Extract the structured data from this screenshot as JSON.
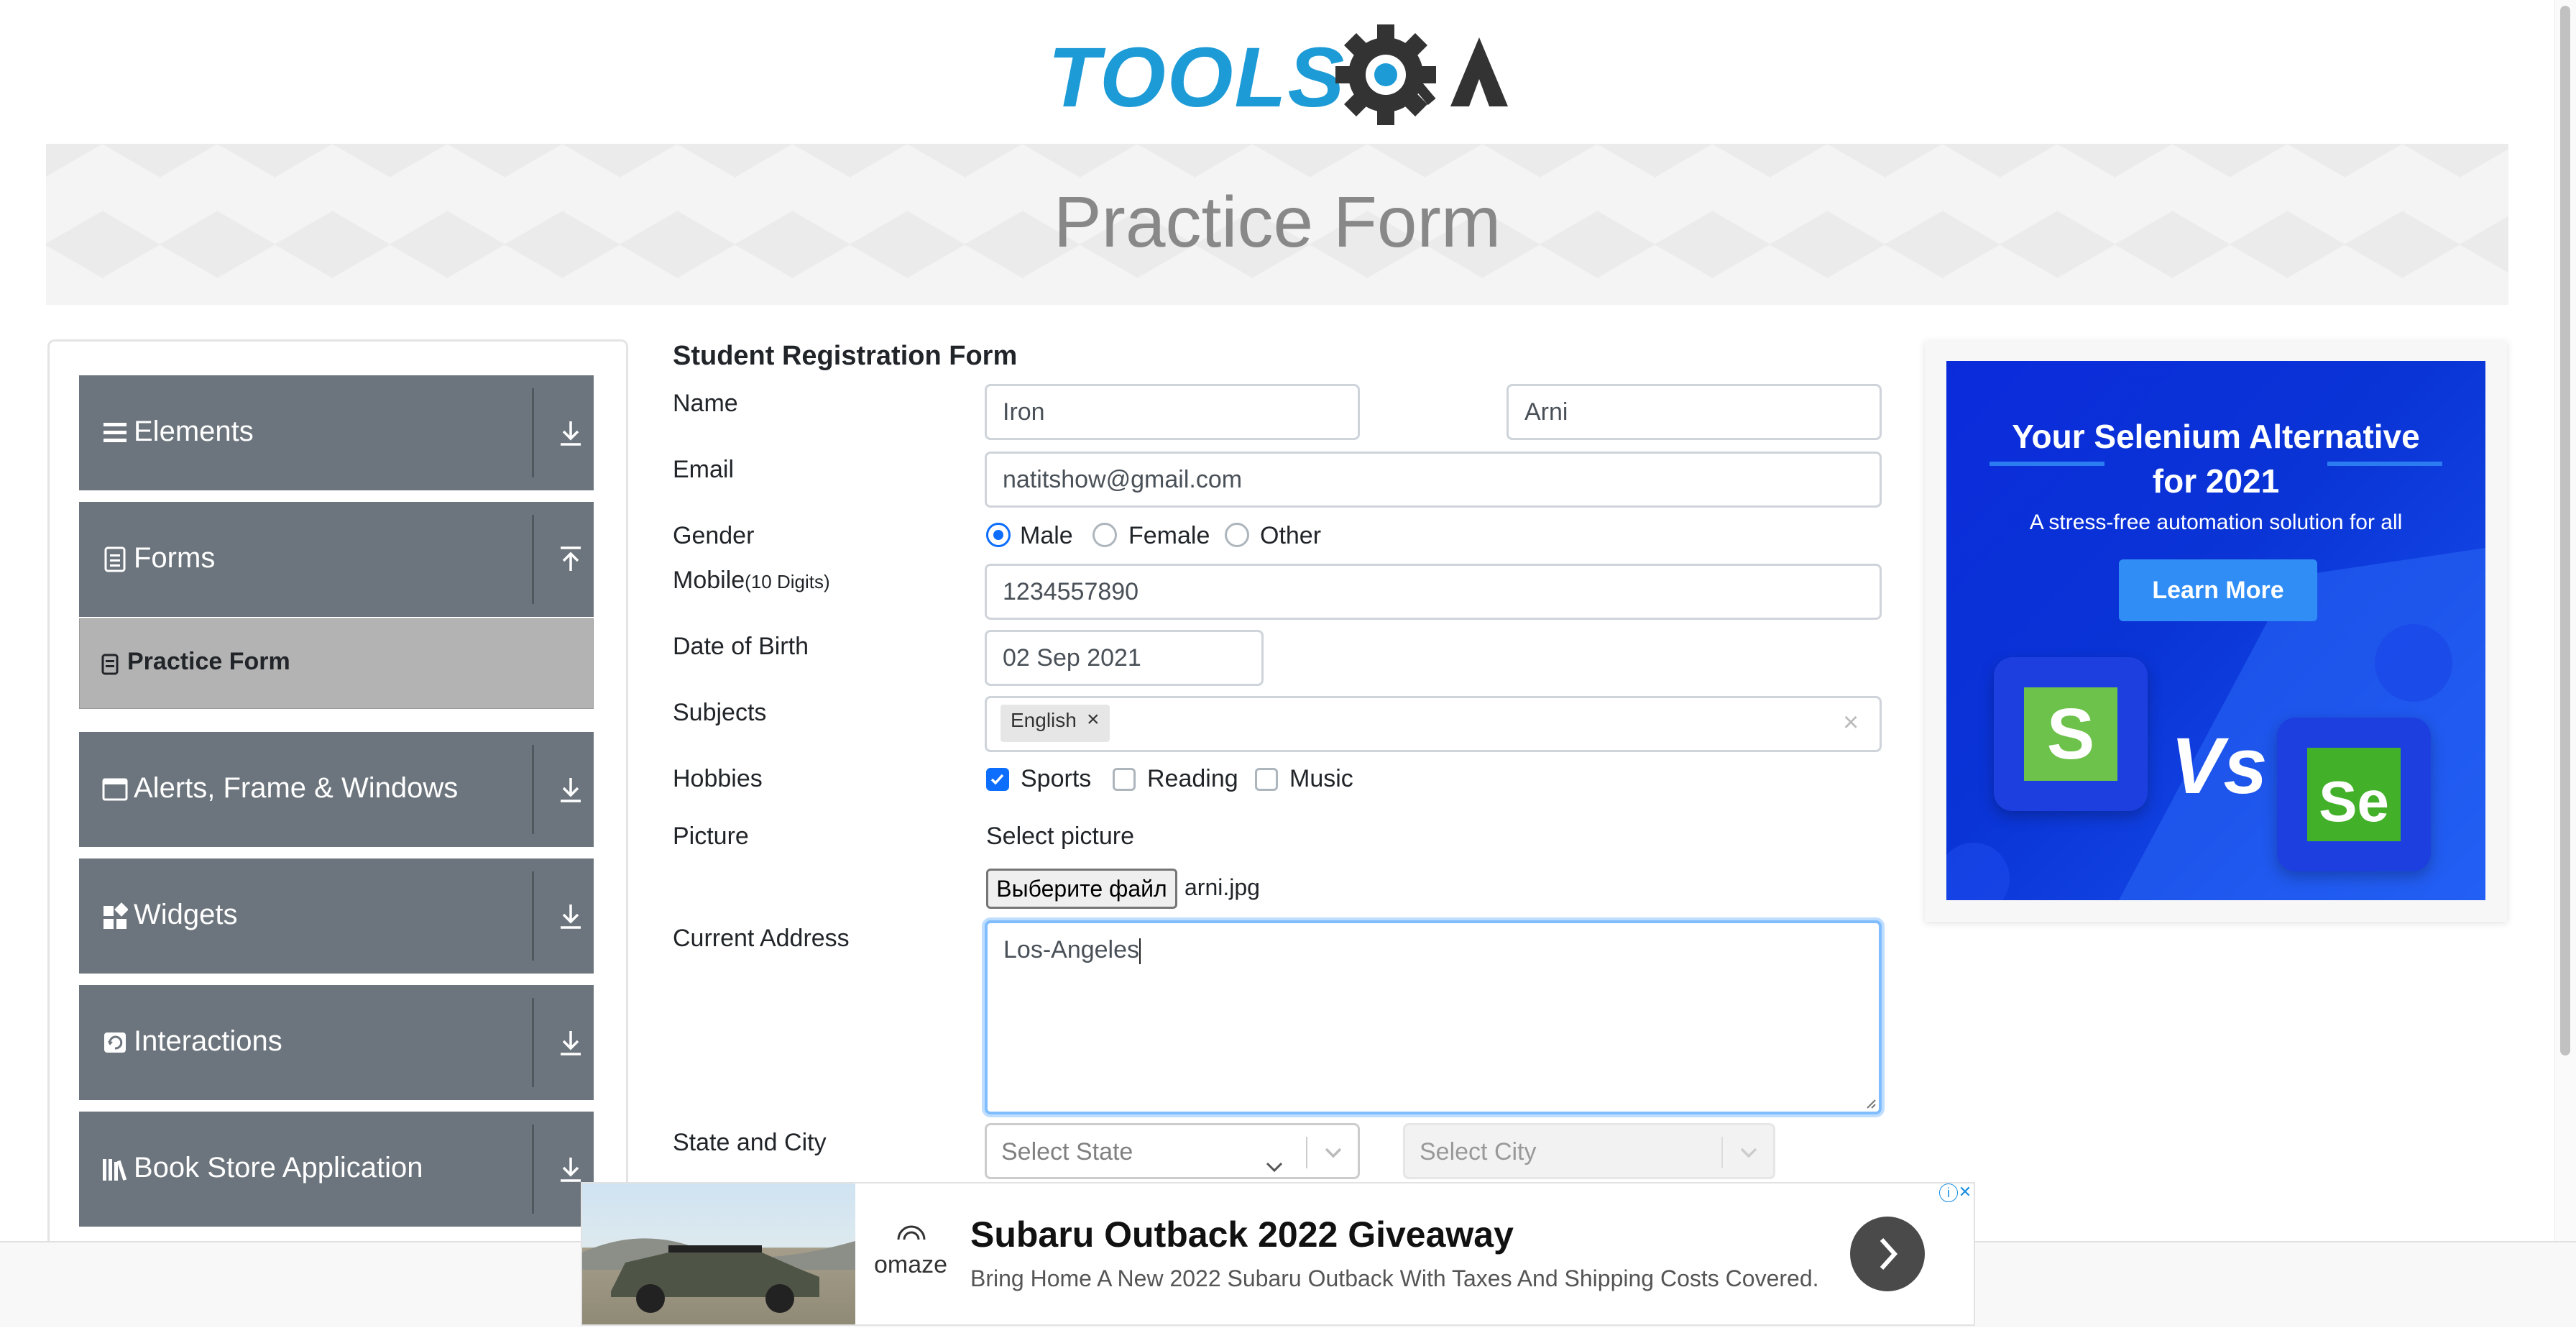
{
  "header": {
    "logo_text_left": "TOOLS",
    "logo_text_right": "QA",
    "page_title": "Practice Form"
  },
  "sidebar": {
    "groups": [
      {
        "label": "Elements",
        "icon": "list-icon",
        "expanded": false
      },
      {
        "label": "Forms",
        "icon": "document-icon",
        "expanded": true
      },
      {
        "label": "Alerts, Frame & Windows",
        "icon": "window-icon",
        "expanded": false
      },
      {
        "label": "Widgets",
        "icon": "widgets-icon",
        "expanded": false
      },
      {
        "label": "Interactions",
        "icon": "interactions-icon",
        "expanded": false
      },
      {
        "label": "Book Store Application",
        "icon": "books-icon",
        "expanded": false
      }
    ],
    "active_item": {
      "label": "Practice Form",
      "icon": "form-icon"
    }
  },
  "form": {
    "title": "Student Registration Form",
    "name_label": "Name",
    "first_name": "Iron",
    "last_name": "Arni",
    "email_label": "Email",
    "email": "natitshow@gmail.com",
    "gender_label": "Gender",
    "genders": [
      {
        "label": "Male",
        "checked": true
      },
      {
        "label": "Female",
        "checked": false
      },
      {
        "label": "Other",
        "checked": false
      }
    ],
    "mobile_label": "Mobile",
    "mobile_hint": "(10 Digits)",
    "mobile": "1234557890",
    "dob_label": "Date of Birth",
    "dob": "02 Sep 2021",
    "subjects_label": "Subjects",
    "subject_chips": [
      "English"
    ],
    "chip_remove": "×",
    "subjects_clear": "×",
    "hobbies_label": "Hobbies",
    "hobbies": [
      {
        "label": "Sports",
        "checked": true
      },
      {
        "label": "Reading",
        "checked": false
      },
      {
        "label": "Music",
        "checked": false
      }
    ],
    "picture_label": "Picture",
    "picture_prompt": "Select picture",
    "file_button": "Выберите файл",
    "file_name": "arni.jpg",
    "address_label": "Current Address",
    "address": "Los-Angeles",
    "state_city_label": "State and City",
    "state_placeholder": "Select State",
    "city_placeholder": "Select City"
  },
  "side_ad": {
    "headline_line1": "Your Selenium Alternative",
    "headline_line2": "for 2021",
    "subline": "A stress-free automation solution for all",
    "button": "Learn More",
    "vs_text": "Vs",
    "left_logo": "S",
    "right_logo": "Se"
  },
  "bottom_ad": {
    "brand": "omaze",
    "title": "Subaru Outback 2022 Giveaway",
    "description": "Bring Home A New 2022 Subaru Outback With Taxes And Shipping Costs Covered.",
    "close": "✕",
    "info": "i"
  },
  "colors": {
    "accent": "#0d6efd",
    "sidebar_group": "#6c757d",
    "sidebar_active": "#b3b3b3",
    "logo_blue": "#1d9bd6",
    "logo_dark": "#333333",
    "ad_blue": "#0b2bdb"
  }
}
